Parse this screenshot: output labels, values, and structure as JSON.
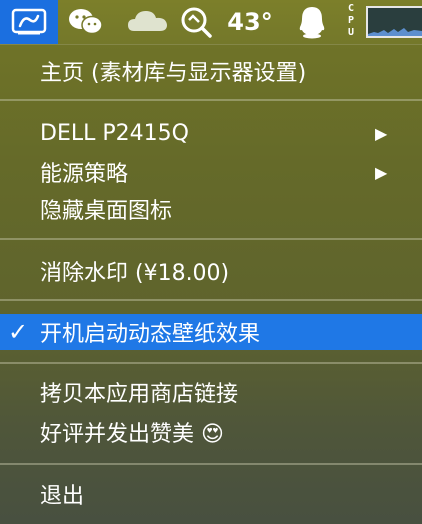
{
  "menubar": {
    "temperature": "43°",
    "cpu_label": "CPU"
  },
  "menu": {
    "home": "主页 (素材库与显示器设置)",
    "display": "DELL P2415Q",
    "energy": "能源策略",
    "hide_icons": "隐藏桌面图标",
    "remove_watermark": "消除水印 (¥18.00)",
    "launch_dynamic": "开机启动动态壁纸效果",
    "copy_link": "拷贝本应用商店链接",
    "review": "好评并发出赞美",
    "quit": "退出",
    "submenu_arrow": "▶",
    "checkmark": "✓",
    "emoji": "😍"
  }
}
